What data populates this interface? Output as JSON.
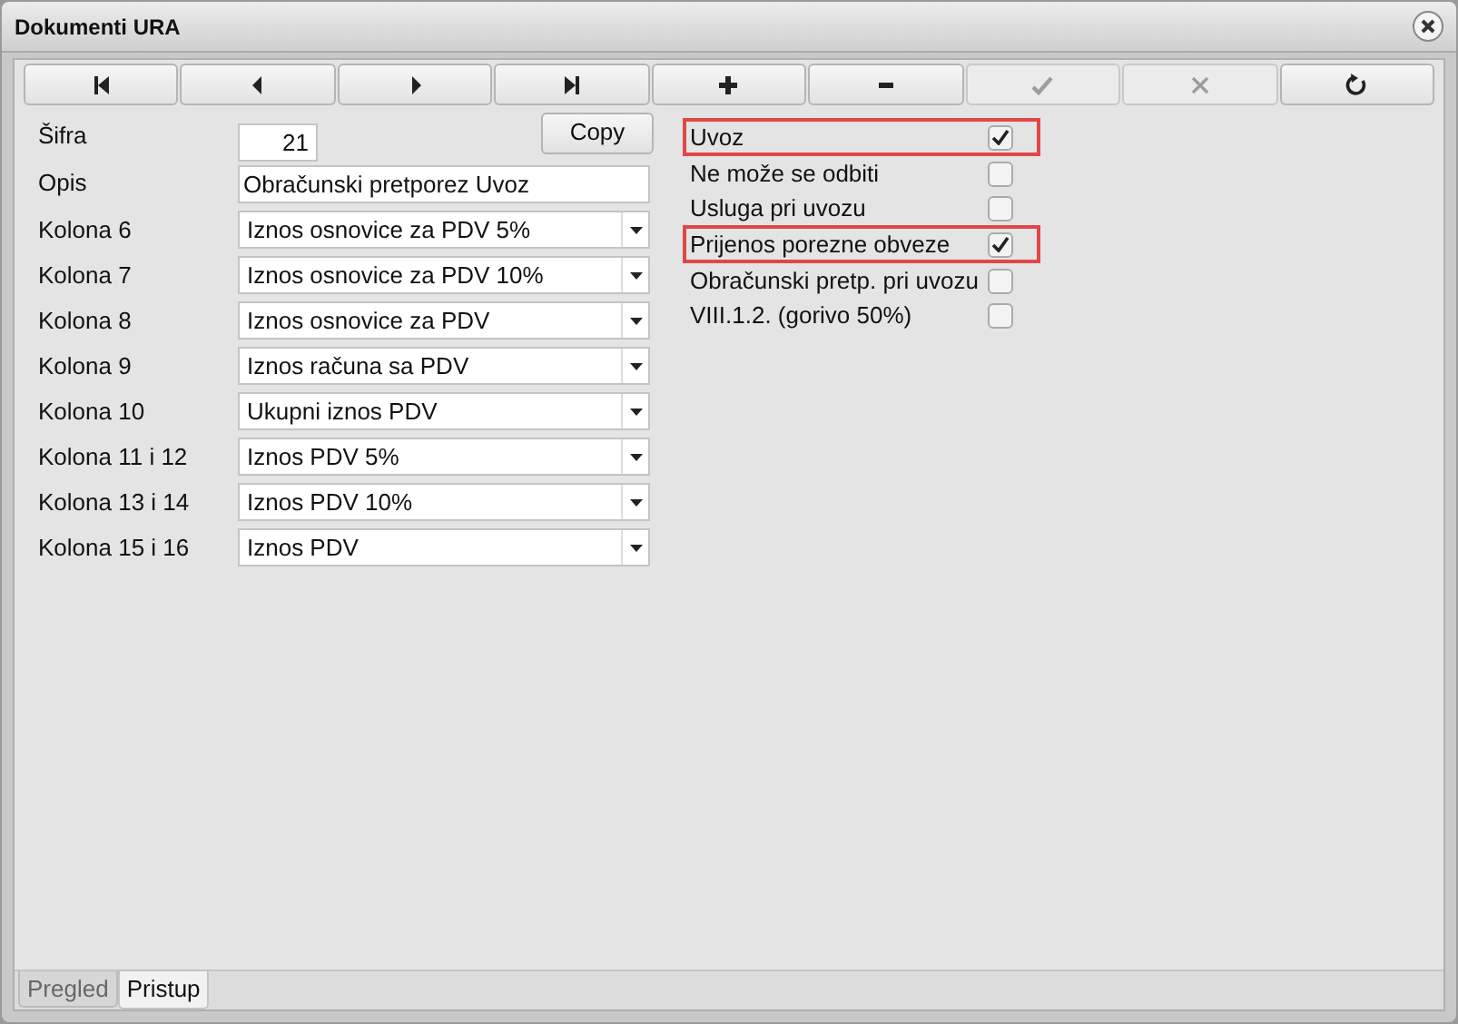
{
  "window": {
    "title": "Dokumenti URA"
  },
  "toolbar": [
    {
      "kind": "first",
      "disabled": false
    },
    {
      "kind": "prev",
      "disabled": false
    },
    {
      "kind": "next",
      "disabled": false
    },
    {
      "kind": "last",
      "disabled": false
    },
    {
      "kind": "add",
      "disabled": false
    },
    {
      "kind": "remove",
      "disabled": false
    },
    {
      "kind": "confirm",
      "disabled": true
    },
    {
      "kind": "cancel",
      "disabled": true
    },
    {
      "kind": "refresh",
      "disabled": false
    }
  ],
  "form": {
    "sifra": {
      "label": "Šifra",
      "value": "21"
    },
    "copy_button": "Copy",
    "opis": {
      "label": "Opis",
      "value": "Obračunski pretporez Uvoz"
    },
    "columns": [
      {
        "label": "Kolona 6",
        "value": "Iznos osnovice za PDV 5%"
      },
      {
        "label": "Kolona 7",
        "value": "Iznos osnovice za PDV 10%"
      },
      {
        "label": "Kolona 8",
        "value": "Iznos osnovice za PDV"
      },
      {
        "label": "Kolona 9",
        "value": "Iznos računa sa PDV"
      },
      {
        "label": "Kolona 10",
        "value": "Ukupni iznos PDV"
      },
      {
        "label": "Kolona 11 i 12",
        "value": "Iznos PDV 5%"
      },
      {
        "label": "Kolona 13 i 14",
        "value": "Iznos PDV 10%"
      },
      {
        "label": "Kolona 15 i 16",
        "value": "Iznos PDV"
      }
    ]
  },
  "options": [
    {
      "label": "Uvoz",
      "checked": true,
      "highlighted": true
    },
    {
      "label": "Ne može se odbiti",
      "checked": false,
      "highlighted": false
    },
    {
      "label": "Usluga pri uvozu",
      "checked": false,
      "highlighted": false
    },
    {
      "label": "Prijenos porezne obveze",
      "checked": true,
      "highlighted": true
    },
    {
      "label": "Obračunski pretp. pri uvozu",
      "checked": false,
      "highlighted": false
    },
    {
      "label": "VIII.1.2. (gorivo 50%)",
      "checked": false,
      "highlighted": false
    }
  ],
  "tabs": [
    {
      "label": "Pregled",
      "selected": false
    },
    {
      "label": "Pristup",
      "selected": true
    }
  ]
}
